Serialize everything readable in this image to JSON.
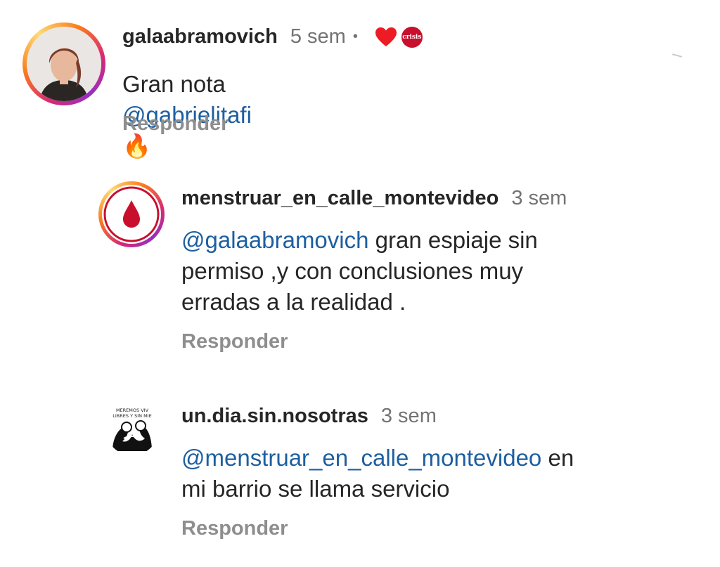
{
  "comments": [
    {
      "username": "galaabramovich",
      "time": "5 sem",
      "dot": "•",
      "mention": "@gabrielitafi",
      "text_before": "Gran nota ",
      "text_after": "",
      "emoji": "🔥",
      "reply": "Responder",
      "badges": {
        "heart_color": "#ed1c24",
        "crisis_label": "crisis"
      }
    },
    {
      "username": "menstruar_en_calle_montevideo",
      "time": "3 sem",
      "mention": "@galaabramovich",
      "text_line1": " gran espiaje sin",
      "text_line2": "permiso ,y con conclusiones muy",
      "text_line3": "erradas a la realidad .",
      "reply": "Responder"
    },
    {
      "username": "un.dia.sin.nosotras",
      "time": "3 sem",
      "mention": "@menstruar_en_calle_montevideo",
      "text_line1": " en",
      "text_line2": "mi barrio se llama servicio",
      "reply": "Responder",
      "avatar_caption_1": "MEREMOS VIV",
      "avatar_caption_2": "LIBRES Y SIN MIE"
    }
  ],
  "colors": {
    "mention": "#1d5fa0",
    "reply": "#8e8e8e",
    "time": "#737373",
    "blood": "#c8102e"
  }
}
